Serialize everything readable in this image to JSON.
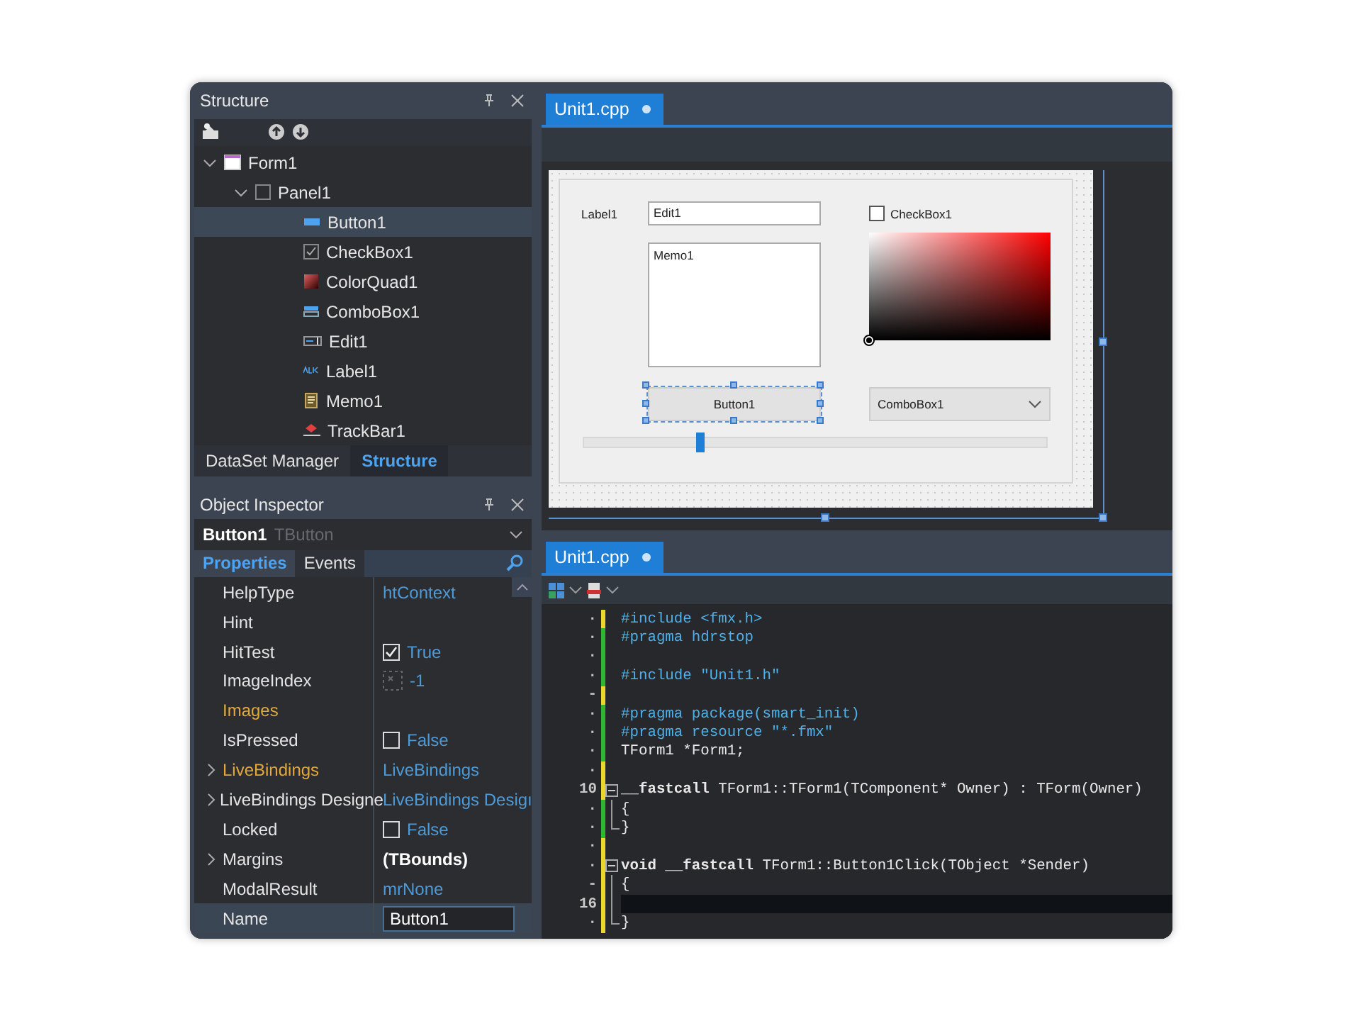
{
  "structure_panel": {
    "title": "Structure",
    "tree": [
      {
        "label": "Form1",
        "kind": "form",
        "expanded": true,
        "selected": false,
        "children": [
          {
            "label": "Panel1",
            "kind": "panel",
            "expanded": true,
            "selected": false,
            "children": [
              {
                "label": "Button1",
                "kind": "button",
                "selected": true
              },
              {
                "label": "CheckBox1",
                "kind": "checkbox",
                "selected": false
              },
              {
                "label": "ColorQuad1",
                "kind": "colorquad",
                "selected": false
              },
              {
                "label": "ComboBox1",
                "kind": "combobox",
                "selected": false
              },
              {
                "label": "Edit1",
                "kind": "edit",
                "selected": false
              },
              {
                "label": "Label1",
                "kind": "label",
                "selected": false
              },
              {
                "label": "Memo1",
                "kind": "memo",
                "selected": false
              },
              {
                "label": "TrackBar1",
                "kind": "trackbar",
                "selected": false
              }
            ]
          }
        ]
      }
    ],
    "tabs": [
      {
        "label": "DataSet Manager",
        "selected": false
      },
      {
        "label": "Structure",
        "selected": true
      }
    ]
  },
  "object_inspector": {
    "title": "Object Inspector",
    "component": {
      "name": "Button1",
      "type": "TButton"
    },
    "tabs": [
      {
        "label": "Properties",
        "selected": true
      },
      {
        "label": "Events",
        "selected": false
      }
    ],
    "properties": [
      {
        "name": "HelpType",
        "value": "htContext",
        "kind": "text",
        "emphasis": false,
        "expandable": false,
        "selected": false,
        "default_value": true
      },
      {
        "name": "Hint",
        "kind": "text",
        "emphasis": false,
        "expandable": false,
        "selected": false
      },
      {
        "name": "HitTest",
        "value": "True",
        "kind": "checkbox",
        "checked": true,
        "emphasis": false,
        "expandable": false,
        "selected": false,
        "default_value": true
      },
      {
        "name": "ImageIndex",
        "value": "-1",
        "kind": "image",
        "emphasis": false,
        "expandable": false,
        "selected": false,
        "default_value": true
      },
      {
        "name": "Images",
        "kind": "text",
        "emphasis": true,
        "expandable": false,
        "selected": false
      },
      {
        "name": "IsPressed",
        "value": "False",
        "kind": "checkbox",
        "checked": false,
        "emphasis": false,
        "expandable": false,
        "selected": false,
        "default_value": true
      },
      {
        "name": "LiveBindings",
        "value": "LiveBindings",
        "kind": "text",
        "emphasis": true,
        "expandable": true,
        "selected": false,
        "default_value": true
      },
      {
        "name": "LiveBindings Designe",
        "value": "LiveBindings Desigı",
        "kind": "text",
        "emphasis": false,
        "expandable": true,
        "selected": false,
        "default_value": true
      },
      {
        "name": "Locked",
        "value": "False",
        "kind": "checkbox",
        "checked": false,
        "emphasis": false,
        "expandable": false,
        "selected": false,
        "default_value": true
      },
      {
        "name": "Margins",
        "value": "(TBounds)",
        "kind": "text",
        "emphasis": false,
        "expandable": true,
        "selected": false,
        "default_value": false
      },
      {
        "name": "ModalResult",
        "value": "mrNone",
        "kind": "text",
        "emphasis": false,
        "expandable": false,
        "selected": false,
        "default_value": true
      },
      {
        "name": "Name",
        "value": "Button1",
        "kind": "text",
        "emphasis": false,
        "expandable": false,
        "selected": true
      }
    ]
  },
  "designer": {
    "tab": {
      "label": "Unit1.cpp",
      "modified": true
    },
    "form": {
      "label": "Label1",
      "edit": "Edit1",
      "memo": "Memo1",
      "checkbox": {
        "label": "CheckBox1",
        "checked": false
      },
      "button": {
        "label": "Button1",
        "selected": true
      },
      "combobox": "ComboBox1",
      "trackbar": {
        "level": 0.25
      }
    }
  },
  "code_editor": {
    "tab": {
      "label": "Unit1.cpp",
      "modified": true
    },
    "lines": [
      {
        "gutter": "·",
        "saved": false,
        "fold_start": false,
        "in_fold": false,
        "fold_end": false,
        "current": false,
        "tokens": [
          {
            "text": "#include <fmx.h>",
            "kind": "directive"
          }
        ]
      },
      {
        "gutter": "·",
        "saved": true,
        "fold_start": false,
        "in_fold": false,
        "fold_end": false,
        "current": false,
        "tokens": [
          {
            "text": "#pragma hdrstop",
            "kind": "directive"
          }
        ]
      },
      {
        "gutter": "·",
        "saved": true,
        "fold_start": false,
        "in_fold": false,
        "fold_end": false,
        "current": false
      },
      {
        "gutter": "·",
        "saved": true,
        "fold_start": false,
        "in_fold": false,
        "fold_end": false,
        "current": false,
        "tokens": [
          {
            "text": "#include \"Unit1.h\"",
            "kind": "directive"
          }
        ]
      },
      {
        "gutter": "-",
        "saved": false,
        "fold_start": false,
        "in_fold": false,
        "fold_end": false,
        "current": false
      },
      {
        "gutter": "·",
        "saved": true,
        "fold_start": false,
        "in_fold": false,
        "fold_end": false,
        "current": false,
        "tokens": [
          {
            "text": "#pragma package(smart_init)",
            "kind": "directive"
          }
        ]
      },
      {
        "gutter": "·",
        "saved": true,
        "fold_start": false,
        "in_fold": false,
        "fold_end": false,
        "current": false,
        "tokens": [
          {
            "text": "#pragma resource \"*.fmx\"",
            "kind": "directive"
          }
        ]
      },
      {
        "gutter": "·",
        "saved": true,
        "fold_start": false,
        "in_fold": false,
        "fold_end": false,
        "current": false,
        "tokens": [
          {
            "text": "TForm1 *Form1;",
            "kind": "plain"
          }
        ]
      },
      {
        "gutter": "·",
        "saved": false,
        "fold_start": false,
        "in_fold": false,
        "fold_end": false,
        "current": false
      },
      {
        "gutter": "10",
        "saved": false,
        "fold_start": true,
        "in_fold": false,
        "fold_end": false,
        "current": false,
        "tokens": [
          {
            "text": "__fastcall",
            "kind": "keyword"
          },
          {
            "text": " TForm1::TForm1(TComponent* Owner) : TForm(Owner)",
            "kind": "plain"
          }
        ]
      },
      {
        "gutter": "·",
        "saved": true,
        "fold_start": false,
        "in_fold": true,
        "fold_end": false,
        "current": false,
        "tokens": [
          {
            "text": "{",
            "kind": "plain"
          }
        ]
      },
      {
        "gutter": "·",
        "saved": true,
        "fold_start": false,
        "in_fold": true,
        "fold_end": true,
        "current": false,
        "tokens": [
          {
            "text": "}",
            "kind": "plain"
          }
        ]
      },
      {
        "gutter": "·",
        "saved": false,
        "fold_start": false,
        "in_fold": false,
        "fold_end": false,
        "current": false
      },
      {
        "gutter": "·",
        "saved": false,
        "fold_start": true,
        "in_fold": false,
        "fold_end": false,
        "current": false,
        "tokens": [
          {
            "text": "void __fastcall",
            "kind": "keyword"
          },
          {
            "text": " TForm1::Button1Click(TObject *Sender)",
            "kind": "plain"
          }
        ]
      },
      {
        "gutter": "-",
        "saved": false,
        "fold_start": false,
        "in_fold": true,
        "fold_end": false,
        "current": false,
        "tokens": [
          {
            "text": "{",
            "kind": "plain"
          }
        ]
      },
      {
        "gutter": "16",
        "saved": false,
        "fold_start": false,
        "in_fold": true,
        "fold_end": false,
        "current": true
      },
      {
        "gutter": "·",
        "saved": false,
        "fold_start": false,
        "in_fold": true,
        "fold_end": true,
        "current": false,
        "tokens": [
          {
            "text": "}",
            "kind": "plain"
          }
        ]
      }
    ]
  }
}
